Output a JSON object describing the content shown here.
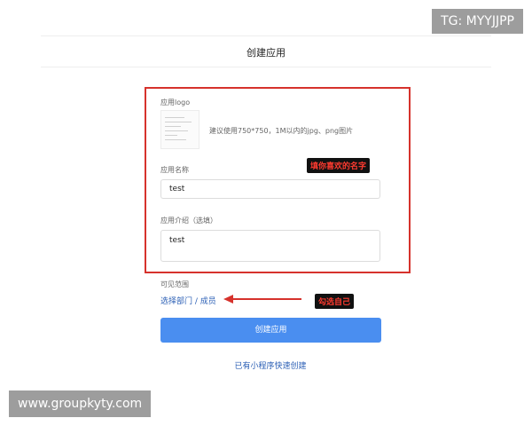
{
  "watermarks": {
    "top_right": "TG: MYYJJPP",
    "bottom_left": "www.groupkyty.com"
  },
  "header": {
    "title": "创建应用"
  },
  "form": {
    "logo_label": "应用logo",
    "logo_hint": "建议使用750*750，1M以内的jpg、png图片",
    "name_label": "应用名称",
    "name_value": "test",
    "intro_label": "应用介绍（选填）",
    "intro_value": "test",
    "visibility_label": "可见范围",
    "visibility_link": "选择部门 / 成员"
  },
  "annotations": {
    "name_hint": "填你喜欢的名字",
    "select_hint": "勾选自己"
  },
  "actions": {
    "create_button": "创建应用",
    "quick_create_link": "已有小程序快速创建"
  },
  "colors": {
    "accent": "#4a8ef0",
    "link": "#2b5fb5",
    "highlight": "#d6322c"
  }
}
